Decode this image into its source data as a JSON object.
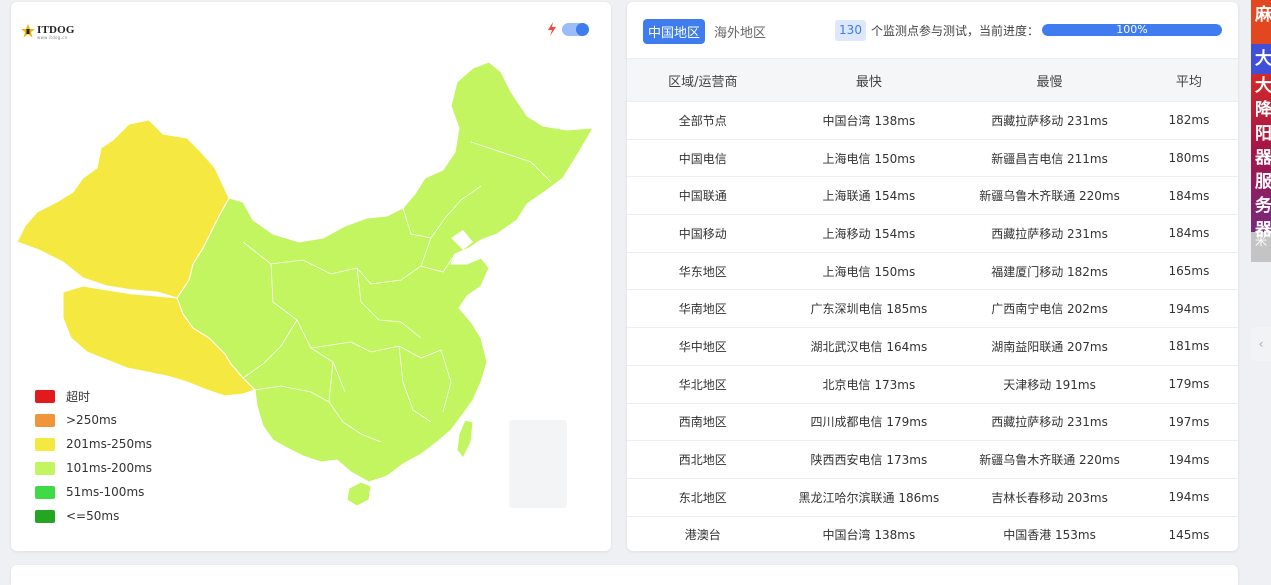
{
  "logo": {
    "text": "ITDOG",
    "subtitle": "www.itdog.cn"
  },
  "legend": [
    {
      "label": "超时",
      "color": "#e31a1c"
    },
    {
      "label": ">250ms",
      "color": "#f0953a"
    },
    {
      "label": "201ms-250ms",
      "color": "#f5e941"
    },
    {
      "label": "101ms-200ms",
      "color": "#c2f560"
    },
    {
      "label": "51ms-100ms",
      "color": "#40da46"
    },
    {
      "label": "<=50ms",
      "color": "#25a623"
    }
  ],
  "map_colors": {
    "west": "#f5e941",
    "main": "#c2f560",
    "island_bg": "#f3f4f6"
  },
  "tabs": [
    {
      "label": "中国地区",
      "active": true
    },
    {
      "label": "海外地区",
      "active": false
    }
  ],
  "monitor": {
    "count": "130",
    "text": "个监测点参与测试，当前进度：",
    "progress_label": "100%",
    "progress_value": 1.0
  },
  "table": {
    "headers": [
      "区域/运营商",
      "最快",
      "最慢",
      "平均"
    ],
    "rows": [
      [
        "全部节点",
        "中国台湾 138ms",
        "西藏拉萨移动 231ms",
        "182ms"
      ],
      [
        "中国电信",
        "上海电信 150ms",
        "新疆昌吉电信 211ms",
        "180ms"
      ],
      [
        "中国联通",
        "上海联通 154ms",
        "新疆乌鲁木齐联通 220ms",
        "184ms"
      ],
      [
        "中国移动",
        "上海移动 154ms",
        "西藏拉萨移动 231ms",
        "184ms"
      ],
      [
        "华东地区",
        "上海电信 150ms",
        "福建厦门移动 182ms",
        "165ms"
      ],
      [
        "华南地区",
        "广东深圳电信 185ms",
        "广西南宁电信 202ms",
        "194ms"
      ],
      [
        "华中地区",
        "湖北武汉电信 164ms",
        "湖南益阳联通 207ms",
        "181ms"
      ],
      [
        "华北地区",
        "北京电信 173ms",
        "天津移动 191ms",
        "179ms"
      ],
      [
        "西南地区",
        "四川成都电信 179ms",
        "西藏拉萨移动 231ms",
        "197ms"
      ],
      [
        "西北地区",
        "陕西西安电信 173ms",
        "新疆乌鲁木齐联通 220ms",
        "194ms"
      ],
      [
        "东北地区",
        "黑龙江哈尔滨联通 186ms",
        "吉林长春移动 203ms",
        "194ms"
      ],
      [
        "港澳台",
        "中国台湾 138ms",
        "中国香港 153ms",
        "145ms"
      ]
    ]
  },
  "ad": {
    "chars": [
      "麻",
      "大",
      "大降",
      "阳",
      "器",
      "服",
      "务",
      "器",
      "米"
    ]
  },
  "side_button": "‹"
}
